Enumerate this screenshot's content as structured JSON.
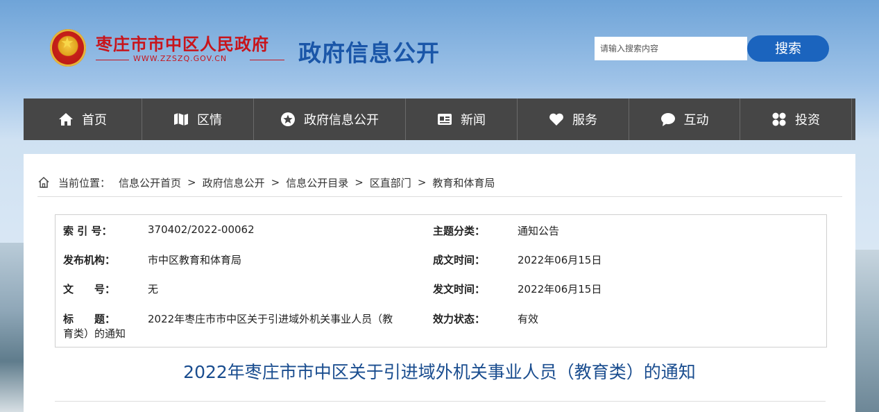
{
  "header": {
    "site_name": "枣庄市市中区人民政府",
    "site_url": "WWW.ZZSZQ.GOV.CN",
    "channel_title": "政府信息公开",
    "search": {
      "placeholder": "请输入搜索内容",
      "button_label": "搜索"
    }
  },
  "nav": {
    "items": [
      {
        "label": "首页",
        "icon": "home-icon"
      },
      {
        "label": "区情",
        "icon": "map-icon"
      },
      {
        "label": "政府信息公开",
        "icon": "star-badge-icon"
      },
      {
        "label": "新闻",
        "icon": "news-card-icon"
      },
      {
        "label": "服务",
        "icon": "heart-icon"
      },
      {
        "label": "互动",
        "icon": "chat-bubble-icon"
      },
      {
        "label": "投资",
        "icon": "grid-icon"
      }
    ]
  },
  "breadcrumb": {
    "prefix": "当前位置：",
    "items": [
      "信息公开首页",
      "政府信息公开",
      "信息公开目录",
      "区直部门",
      "教育和体育局"
    ],
    "separator": ">"
  },
  "meta": {
    "index_label": "索 引 号：",
    "index_value": "370402/2022-00062",
    "topic_label": "主题分类：",
    "topic_value": "通知公告",
    "publisher_label": "发布机构：",
    "publisher_value": "市中区教育和体育局",
    "created_label": "成文时间：",
    "created_value": "2022年06月15日",
    "docno_label": "文　　号：",
    "docno_value": "无",
    "issued_label": "发文时间：",
    "issued_value": "2022年06月15日",
    "title_label": "标　　题：",
    "title_value_line1": "2022年枣庄市市中区关于引进域外机关事业人员（教",
    "title_value_line2": "育类）的通知",
    "status_label": "效力状态：",
    "status_value": "有效"
  },
  "document": {
    "title": "2022年枣庄市市中区关于引进域外机关事业人员（教育类）的通知"
  },
  "colors": {
    "site_red": "#c8141b",
    "channel_blue": "#1a56a8",
    "nav_bg": "#464646",
    "search_button": "#1b64be",
    "doc_title": "#1a4d8f"
  }
}
